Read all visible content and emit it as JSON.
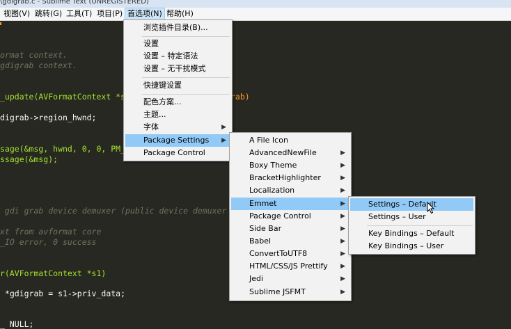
{
  "window": {
    "title": "\\gdigrab.c - Sublime Text (UNREGISTERED)"
  },
  "menubar": [
    {
      "label": "视图(V)"
    },
    {
      "label": "跳转(G)"
    },
    {
      "label": "工具(T)"
    },
    {
      "label": "项目(P)"
    },
    {
      "label": "首选项(N)"
    },
    {
      "label": "帮助(H)"
    }
  ],
  "editor": {
    "lines": [
      "ormat context.",
      "gdigrab context.",
      "_update(AVFormatContext *s",
      "rab)",
      "digrab->region_hwnd;",
      "sage(&msg, hwnd, 0, 0, PM_",
      "ssage(&msg);",
      " gdi grab device demuxer (public device demuxer",
      "xt from avformat core",
      "_IO error, 0 success",
      "r(AVFormatContext *s1)",
      " *gdigrab = s1->priv_data;",
      "_ NULL;"
    ]
  },
  "preferences_menu": {
    "items": [
      {
        "label": "浏览插件目录(B)..."
      },
      {
        "label": "设置"
      },
      {
        "label": "设置 – 特定语法"
      },
      {
        "label": "设置 – 无干扰模式"
      },
      {
        "label": "快捷键设置"
      },
      {
        "label": "配色方案..."
      },
      {
        "label": "主题..."
      },
      {
        "label": "字体"
      },
      {
        "label": "Package Settings"
      },
      {
        "label": "Package Control"
      }
    ]
  },
  "package_settings_menu": {
    "items": [
      {
        "label": "A File Icon"
      },
      {
        "label": "AdvancedNewFile"
      },
      {
        "label": "Boxy Theme"
      },
      {
        "label": "BracketHighlighter"
      },
      {
        "label": "Localization"
      },
      {
        "label": "Emmet"
      },
      {
        "label": "Package Control"
      },
      {
        "label": "Side Bar"
      },
      {
        "label": "Babel"
      },
      {
        "label": "ConvertToUTF8"
      },
      {
        "label": "HTML/CSS/JS Prettify"
      },
      {
        "label": "Jedi"
      },
      {
        "label": "Sublime JSFMT"
      }
    ]
  },
  "emmet_menu": {
    "items": [
      {
        "label": "Settings – Default"
      },
      {
        "label": "Settings – User"
      },
      {
        "label": "Key Bindings – Default"
      },
      {
        "label": "Key Bindings – User"
      }
    ]
  },
  "icons": {
    "submenu_arrow": "chevron-right-icon",
    "pointer": "mouse-pointer-icon"
  },
  "colors": {
    "editor_bg": "#272822",
    "menu_bg": "#f2f2f2",
    "highlight": "#91c9f7",
    "comment": "#75715e"
  }
}
